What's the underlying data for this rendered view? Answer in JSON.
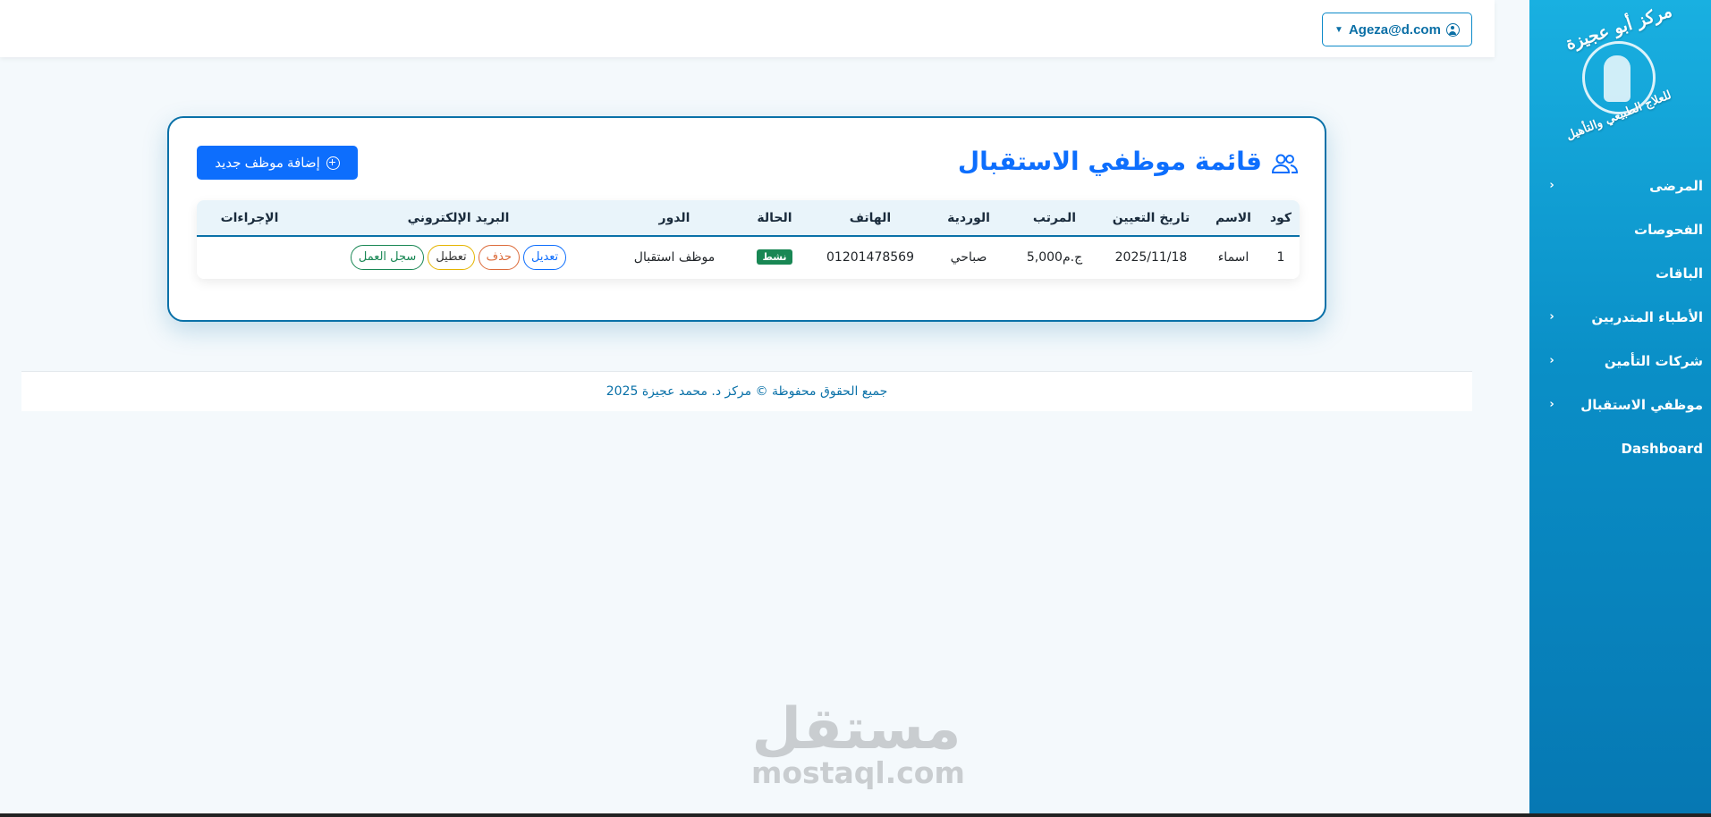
{
  "app": {
    "brand_colors": {
      "sidebar_top": "#19b0e1",
      "sidebar_bottom": "#0678b3",
      "primary": "#0d6efd",
      "accent": "#0a71a8"
    }
  },
  "sidebar": {
    "logo": {
      "line1": "مركز أبو عجيزة",
      "line2": "للعلاج الطبيعي والتأهيل"
    },
    "items": [
      {
        "label": "المرضى",
        "has_submenu": true,
        "icon": "chevron-left-icon"
      },
      {
        "label": "الفحوصات",
        "has_submenu": false
      },
      {
        "label": "الباقات",
        "has_submenu": false
      },
      {
        "label": "الأطباء المتدربين",
        "has_submenu": true,
        "icon": "chevron-left-icon"
      },
      {
        "label": "شركات التأمين",
        "has_submenu": true,
        "icon": "chevron-left-icon"
      },
      {
        "label": "موظفي الاستقبال",
        "has_submenu": true,
        "icon": "chevron-left-icon"
      },
      {
        "label": "Dashboard",
        "has_submenu": false
      }
    ]
  },
  "topbar": {
    "user_email": "Ageza@d.com",
    "user_icon": "user-circle-icon",
    "caret_icon": "caret-down-icon"
  },
  "page": {
    "title": "قائمة موظفي الاستقبال",
    "title_icon": "people-icon",
    "add_button_label": "إضافة موظف جديد",
    "add_button_icon": "plus-circle-icon"
  },
  "table": {
    "headers": [
      "كود",
      "الاسم",
      "تاريخ التعيين",
      "المرتب",
      "الوردية",
      "الهاتف",
      "الحالة",
      "الدور",
      "البريد الإلكتروني",
      "الإجراءات"
    ],
    "rows": [
      {
        "code": "1",
        "name": "اسماء",
        "hire_date": "2025/11/18",
        "salary": "ج.م5,000",
        "shift": "صباحي",
        "phone": "01201478569",
        "status": "نشط",
        "role": "موظف استقبال",
        "email": "",
        "actions": {
          "edit": "تعديل",
          "delete": "حذف",
          "disable": "تعطيل",
          "log": "سجل العمل"
        }
      }
    ]
  },
  "footer": {
    "text": "جميع الحقوق محفوظة © مركز د. محمد عجيزة 2025"
  },
  "watermark": {
    "ar": "مستقل",
    "en": "mostaql.com"
  }
}
